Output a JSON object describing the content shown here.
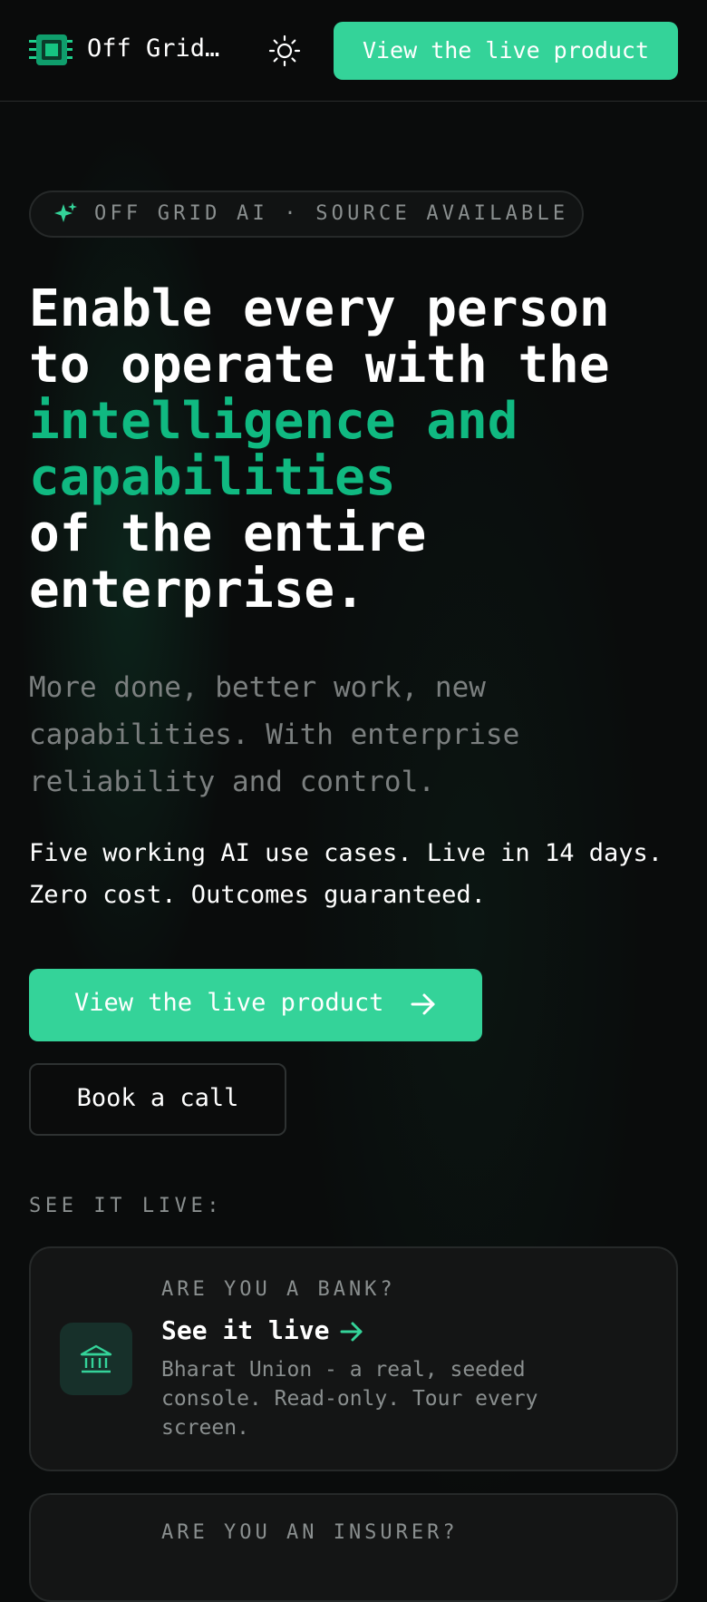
{
  "header": {
    "brand_name": "Off Grid…",
    "cta_label": "View the live product",
    "logo_icon": "chip-icon",
    "theme_icon": "sun-icon"
  },
  "hero": {
    "badge": "OFF GRID AI · SOURCE AVAILABLE",
    "headline": {
      "line1": "Enable every person",
      "line2": "to operate with the",
      "accent_line1": "intelligence and",
      "accent_line2": "capabilities",
      "line3": "of the entire",
      "line4": "enterprise."
    },
    "subtitle": "More done, better work, new capabilities. With enterprise reliability and control.",
    "tagline": "Five working AI use cases. Live in 14 days. Zero cost. Outcomes guaranteed.",
    "primary_cta": "View the live product",
    "secondary_cta": "Book a call"
  },
  "live": {
    "label": "SEE IT LIVE:",
    "cards": [
      {
        "eyebrow": "ARE YOU A BANK?",
        "title": "See it live",
        "description": "Bharat Union - a real, seeded console. Read-only. Tour every screen.",
        "icon": "bank-icon"
      },
      {
        "eyebrow": "ARE YOU AN INSURER?"
      }
    ]
  },
  "colors": {
    "accent": "#34d399",
    "accent_text": "#10b981",
    "background": "#0a0c0c",
    "muted": "#8a8f8f"
  }
}
